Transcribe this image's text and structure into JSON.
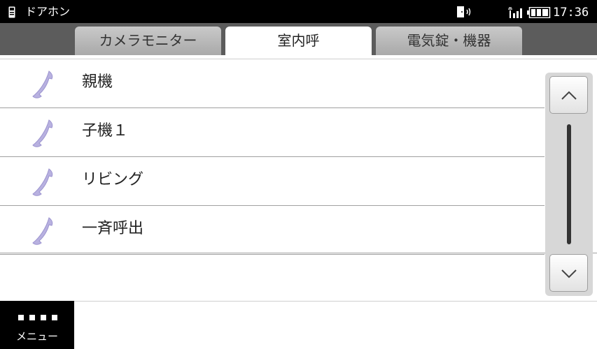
{
  "status_bar": {
    "app_title": "ドアホン",
    "time": "17:36",
    "icons": [
      "doorphone-app-icon",
      "door-chime-icon",
      "signal-icon",
      "battery-icon"
    ]
  },
  "tabs": [
    {
      "label": "カメラモニター",
      "active": false
    },
    {
      "label": "室内呼",
      "active": true
    },
    {
      "label": "電気錠・機器",
      "active": false
    }
  ],
  "list": {
    "items": [
      {
        "label": "親機",
        "icon": "phone-handset-icon"
      },
      {
        "label": "子機１",
        "icon": "phone-handset-icon"
      },
      {
        "label": "リビング",
        "icon": "phone-handset-icon"
      },
      {
        "label": "一斉呼出",
        "icon": "phone-handset-icon"
      }
    ]
  },
  "scrollbar": {
    "up_icon": "chevron-up-icon",
    "down_icon": "chevron-down-icon"
  },
  "menu": {
    "label": "メニュー"
  },
  "colors": {
    "status_bar_bg": "#000000",
    "tab_bar_bg": "#5c5c5c",
    "tab_inactive": "#b8b8b8",
    "tab_active": "#ffffff",
    "phone_icon": "#b8b1e0",
    "scroll_track": "#d7d7d7"
  }
}
